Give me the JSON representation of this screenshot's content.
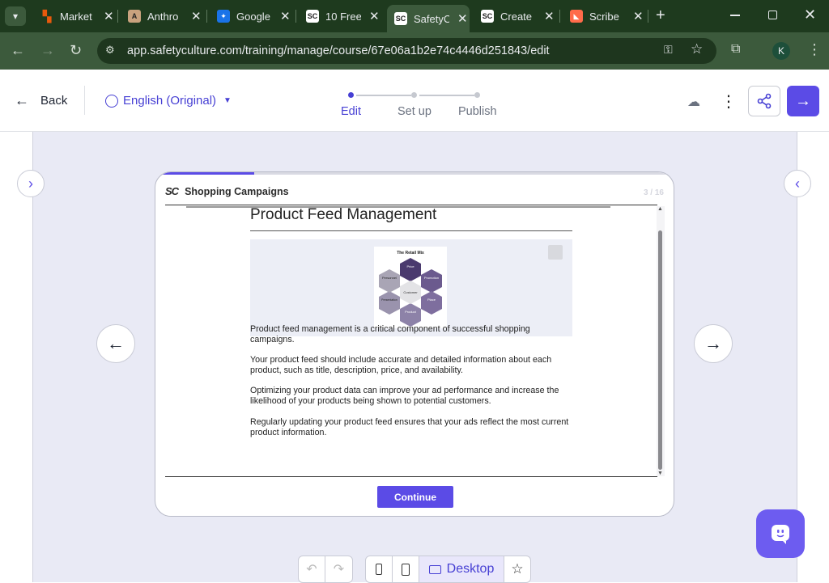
{
  "browser": {
    "tabs": [
      {
        "title": "Market",
        "icon": "marketo-icon",
        "color": "#e8590c"
      },
      {
        "title": "Anthro",
        "icon": "anthropic-icon",
        "color": "#c9a27e"
      },
      {
        "title": "Google",
        "icon": "google-icon",
        "color": "#1a73e8"
      },
      {
        "title": "10 Free",
        "icon": "sc-icon",
        "color": "#ffffff"
      },
      {
        "title": "SafetyC",
        "icon": "sc-icon",
        "color": "#ffffff"
      },
      {
        "title": "Create",
        "icon": "sc-icon",
        "color": "#ffffff"
      },
      {
        "title": "Scribe",
        "icon": "scribe-icon",
        "color": "#ff6b4a"
      }
    ],
    "url": "app.safetyculture.com/training/manage/course/67e06a1b2e74c4446d251843/edit",
    "profile_initial": "K"
  },
  "header": {
    "back_label": "Back",
    "language": "English (Original)",
    "steps": [
      "Edit",
      "Set up",
      "Publish"
    ]
  },
  "course": {
    "logo": "SC",
    "title": "Shopping Campaigns",
    "page": "3 / 16",
    "progress_fraction": 0.19
  },
  "slide": {
    "title": "Product Feed Management",
    "image": {
      "title": "The Retail Mix",
      "center": "Customer",
      "segments": [
        "Price",
        "Promotion",
        "Place",
        "Product",
        "Presentation",
        "Personnel"
      ]
    },
    "paragraphs": [
      "Product feed management is a critical component of successful shopping campaigns.",
      "Your product feed should include accurate and detailed information about each product, such as title, description, price, and availability.",
      "Optimizing your product data can improve your ad performance and increase the likelihood of your products being shown to potential customers.",
      "Regularly updating your product feed ensures that your ads reflect the most current product information."
    ],
    "continue_label": "Continue"
  },
  "bottom": {
    "desktop_label": "Desktop"
  },
  "colors": {
    "accent": "#5b4be6",
    "browser_bg": "#1e3a1e"
  }
}
